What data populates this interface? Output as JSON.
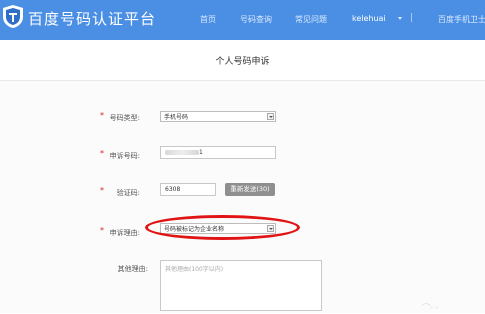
{
  "header": {
    "brand": "百度号码认证平台",
    "nav": [
      "首页",
      "号码查询",
      "常见问题",
      "kelehuai",
      "|",
      "百度手机卫士"
    ],
    "bg_color": "#4a8fe4",
    "logo_icon": "shield-logo-icon"
  },
  "page": {
    "title": "个人号码申诉"
  },
  "form": {
    "type_label": "号码类型:",
    "type_value": "手机号码",
    "phone_label": "申诉号码:",
    "phone_suffix": "1",
    "code_label": "验证码:",
    "code_value": "6308",
    "resend_label": "重新发送(30)",
    "reason_label": "申诉理由:",
    "reason_value": "号码被标记为企业名称",
    "other_label": "其他理由:",
    "other_placeholder": "其他理由(100字以内)",
    "required_mark": "*"
  },
  "colors": {
    "required": "#e02020",
    "highlight": "#e01414",
    "button": "#8f8f8f"
  }
}
